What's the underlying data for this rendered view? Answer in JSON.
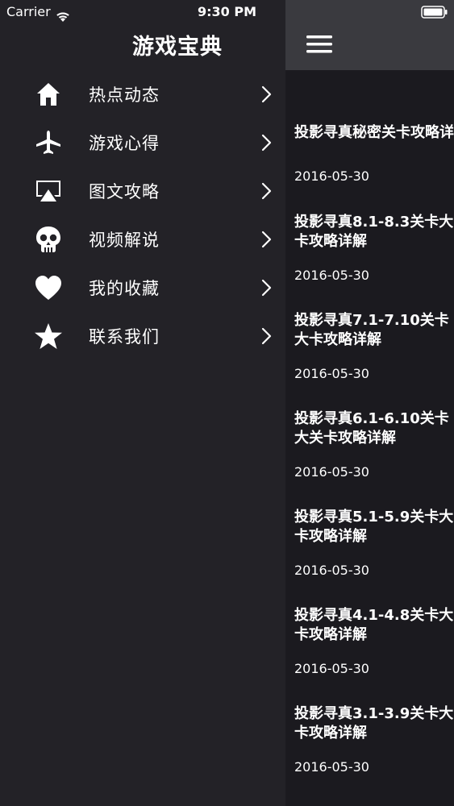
{
  "status_bar": {
    "carrier": "Carrier",
    "time": "9:30 PM"
  },
  "drawer": {
    "title": "游戏宝典",
    "items": [
      {
        "label": "热点动态",
        "icon": "home-icon"
      },
      {
        "label": "游戏心得",
        "icon": "airplane-icon"
      },
      {
        "label": "图文攻略",
        "icon": "airplay-icon"
      },
      {
        "label": "视频解说",
        "icon": "skull-icon"
      },
      {
        "label": "我的收藏",
        "icon": "heart-icon"
      },
      {
        "label": "联系我们",
        "icon": "star-icon"
      }
    ]
  },
  "content": {
    "menu_icon": "hamburger-menu-icon",
    "articles": [
      {
        "title": "投影寻真秘密关卡攻略详解",
        "date": "2016-05-30"
      },
      {
        "title": "投影寻真8.1-8.3关卡大卡攻略详解",
        "date": "2016-05-30"
      },
      {
        "title": "投影寻真7.1-7.10关卡大卡攻略详解",
        "date": "2016-05-30"
      },
      {
        "title": "投影寻真6.1-6.10关卡大关卡攻略详解",
        "date": "2016-05-30"
      },
      {
        "title": "投影寻真5.1-5.9关卡大卡攻略详解",
        "date": "2016-05-30"
      },
      {
        "title": "投影寻真4.1-4.8关卡大卡攻略详解",
        "date": "2016-05-30"
      },
      {
        "title": "投影寻真3.1-3.9关卡大卡攻略详解",
        "date": "2016-05-30"
      }
    ]
  },
  "colors": {
    "drawer_bg": "#232227",
    "content_bg": "#1b1a1f",
    "nav_bar_bg": "#3a3a3f",
    "text": "#ffffff"
  }
}
